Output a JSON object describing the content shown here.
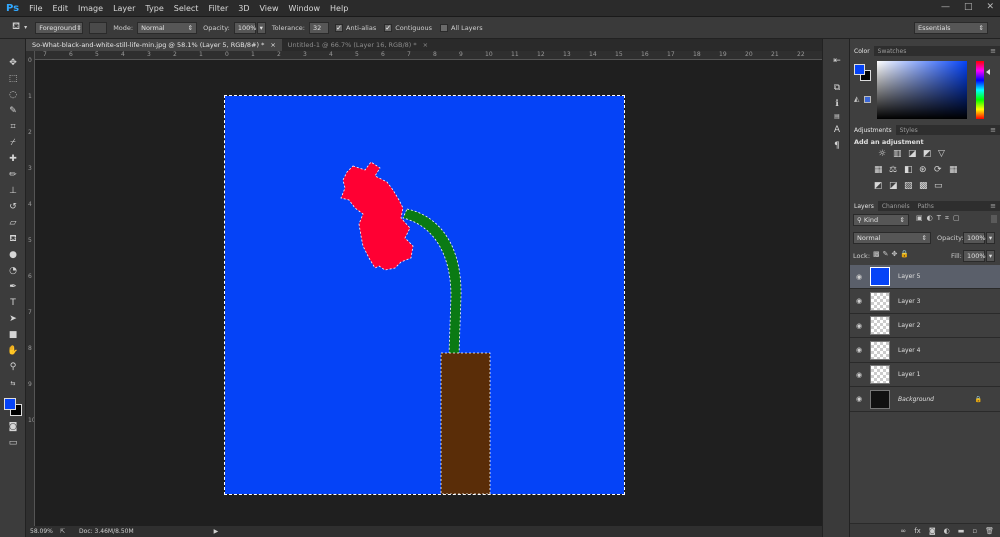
{
  "app": {
    "logo": "Ps"
  },
  "menu": [
    "File",
    "Edit",
    "Image",
    "Layer",
    "Type",
    "Select",
    "Filter",
    "3D",
    "View",
    "Window",
    "Help"
  ],
  "window_controls": {
    "minimize": "—",
    "maximize": "□",
    "close": "✕"
  },
  "options": {
    "fill_source": "Foreground",
    "mode_label": "Mode:",
    "mode_value": "Normal",
    "opacity_label": "Opacity:",
    "opacity_value": "100%",
    "tolerance_label": "Tolerance:",
    "tolerance_value": "32",
    "antialias_label": "Anti-alias",
    "contiguous_label": "Contiguous",
    "all_layers_label": "All Layers",
    "workspace": "Essentials"
  },
  "tabs": [
    {
      "label": "So-What-black-and-white-still-life-min.jpg @ 58.1% (Layer 5, RGB/8#) *",
      "close": "×"
    },
    {
      "label": "Untitled-1 @ 66.7% (Layer 16, RGB/8) *",
      "close": "×"
    }
  ],
  "ruler_top": [
    "7",
    "6",
    "5",
    "4",
    "3",
    "2",
    "1",
    "0",
    "1",
    "2",
    "3",
    "4",
    "5",
    "6",
    "7",
    "8",
    "9",
    "10",
    "11",
    "12",
    "13",
    "14",
    "15",
    "16",
    "17",
    "18",
    "19",
    "20",
    "21",
    "22"
  ],
  "ruler_left": [
    "0",
    "1",
    "2",
    "3",
    "4",
    "5",
    "6",
    "7",
    "8",
    "9",
    "10"
  ],
  "status": {
    "zoom": "58.09%",
    "doc": "Doc: 3.46M/8.50M",
    "arrow": "▶"
  },
  "colors": {
    "foreground": "#0543f7",
    "background": "#000000",
    "canvas_fill": "#0543f7",
    "flower": "#ff0033",
    "stem": "#0a7a14",
    "vase": "#5a2d08"
  },
  "color_panel": {
    "tab_color": "Color",
    "tab_swatches": "Swatches"
  },
  "adjustments_panel": {
    "tab_adjustments": "Adjustments",
    "tab_styles": "Styles",
    "title": "Add an adjustment"
  },
  "layers_panel": {
    "tab_layers": "Layers",
    "tab_channels": "Channels",
    "tab_paths": "Paths",
    "filter_kind": "Kind",
    "blend_mode": "Normal",
    "opacity_label": "Opacity:",
    "opacity_value": "100%",
    "lock_label": "Lock:",
    "fill_label": "Fill:",
    "fill_value": "100%",
    "layers": [
      {
        "name": "Layer 5",
        "selected": true
      },
      {
        "name": "Layer 3",
        "selected": false
      },
      {
        "name": "Layer 2",
        "selected": false
      },
      {
        "name": "Layer 4",
        "selected": false
      },
      {
        "name": "Layer 1",
        "selected": false
      },
      {
        "name": "Background",
        "selected": false
      }
    ],
    "bottom_icons": [
      "link-icon",
      "fx-icon",
      "mask-icon",
      "adjustment-icon",
      "folder-icon",
      "new-layer-icon",
      "trash-icon"
    ],
    "fx_label": "fx"
  }
}
